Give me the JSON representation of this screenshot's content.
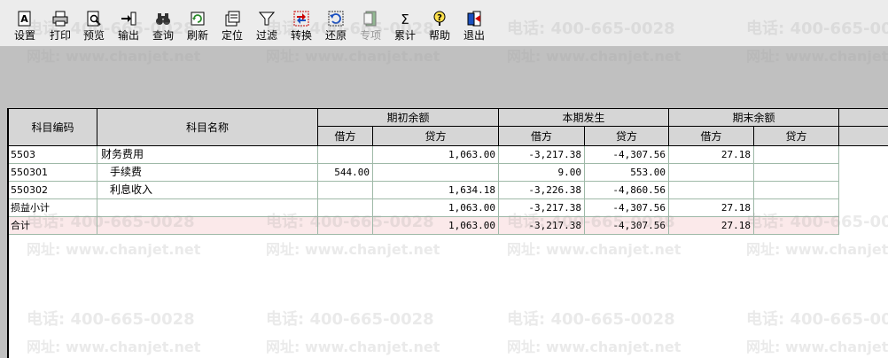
{
  "toolbar": {
    "buttons": [
      {
        "label": "设置",
        "icon": "setup-icon"
      },
      {
        "label": "打印",
        "icon": "printer-icon"
      },
      {
        "label": "预览",
        "icon": "preview-icon"
      },
      {
        "label": "输出",
        "icon": "export-icon"
      },
      {
        "label": "查询",
        "icon": "binoculars-icon"
      },
      {
        "label": "刷新",
        "icon": "refresh-icon"
      },
      {
        "label": "定位",
        "icon": "locate-icon"
      },
      {
        "label": "过滤",
        "icon": "filter-icon"
      },
      {
        "label": "转换",
        "icon": "convert-icon"
      },
      {
        "label": "还原",
        "icon": "restore-icon"
      },
      {
        "label": "专项",
        "icon": "special-icon",
        "disabled": true
      },
      {
        "label": "累计",
        "icon": "sigma-icon"
      },
      {
        "label": "帮助",
        "icon": "help-icon"
      },
      {
        "label": "退出",
        "icon": "exit-icon"
      }
    ]
  },
  "table": {
    "headers": {
      "code": "科目编码",
      "name": "科目名称",
      "opening": "期初余额",
      "period": "本期发生",
      "closing": "期末余额",
      "debit": "借方",
      "credit": "贷方"
    },
    "rows": [
      {
        "code": "5503",
        "name": "财务费用",
        "indent": 0,
        "open_debit": "",
        "open_credit": "1,063.00",
        "per_debit": "-3,217.38",
        "per_credit": "-4,307.56",
        "close_debit": "27.18",
        "close_credit": ""
      },
      {
        "code": "550301",
        "name": "手续费",
        "indent": 1,
        "open_debit": "544.00",
        "open_credit": "",
        "per_debit": "9.00",
        "per_credit": "553.00",
        "close_debit": "",
        "close_credit": ""
      },
      {
        "code": "550302",
        "name": "利息收入",
        "indent": 1,
        "open_debit": "",
        "open_credit": "1,634.18",
        "per_debit": "-3,226.38",
        "per_credit": "-4,860.56",
        "close_debit": "",
        "close_credit": ""
      },
      {
        "code": "损益小计",
        "name": "",
        "indent": 0,
        "open_debit": "",
        "open_credit": "1,063.00",
        "per_debit": "-3,217.38",
        "per_credit": "-4,307.56",
        "close_debit": "27.18",
        "close_credit": ""
      },
      {
        "code": "合计",
        "name": "",
        "indent": 0,
        "open_debit": "",
        "open_credit": "1,063.00",
        "per_debit": "-3,217.38",
        "per_credit": "-4,307.56",
        "close_debit": "27.18",
        "close_credit": "",
        "total": true
      }
    ]
  },
  "watermark": {
    "phone": "电话: 400-665-0028",
    "url": "网址: www.chanjet.net"
  },
  "colors": {
    "toolbar_bg": "#ececec",
    "header_bg": "#d6d6d6",
    "workspace_bg": "#c0c0c0",
    "grid_line": "#9fb9a8",
    "total_row_bg": "#fbe9ea"
  }
}
